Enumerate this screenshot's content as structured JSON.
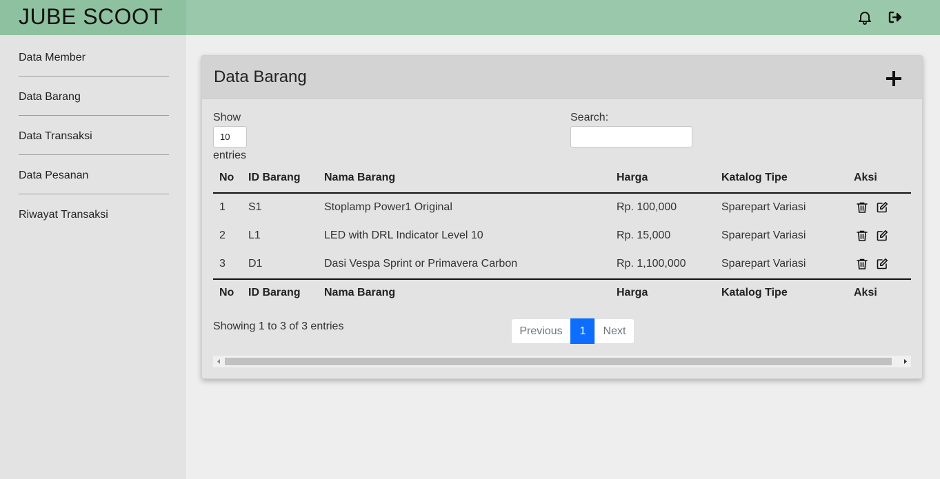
{
  "app": {
    "brand": "JUBE SCOOT"
  },
  "topbar": {
    "icons": [
      "bell-icon",
      "sign-out-icon"
    ]
  },
  "sidebar": {
    "items": [
      {
        "label": "Data Member"
      },
      {
        "label": "Data Barang"
      },
      {
        "label": "Data Transaksi"
      },
      {
        "label": "Data Pesanan"
      },
      {
        "label": "Riwayat Transaksi"
      }
    ]
  },
  "card": {
    "title": "Data Barang",
    "add_icon": "plus-icon"
  },
  "controls": {
    "show_label": "Show",
    "entries_value": "10",
    "entries_label": "entries",
    "search_label": "Search:",
    "search_value": ""
  },
  "table": {
    "columns": [
      "No",
      "ID Barang",
      "Nama Barang",
      "Harga",
      "Katalog Tipe",
      "Aksi"
    ],
    "rows": [
      [
        "1",
        "S1",
        "Stoplamp Power1 Original",
        "Rp. 100,000",
        "Sparepart Variasi"
      ],
      [
        "2",
        "L1",
        "LED with DRL Indicator Level 10",
        "Rp. 15,000",
        "Sparepart Variasi"
      ],
      [
        "3",
        "D1",
        "Dasi Vespa Sprint or Primavera Carbon",
        "Rp. 1,100,000",
        "Sparepart Variasi"
      ]
    ],
    "action_icons": [
      "trash-icon",
      "edit-icon"
    ]
  },
  "footer": {
    "info": "Showing 1 to 3 of 3 entries",
    "previous": "Previous",
    "page": "1",
    "next": "Next"
  },
  "colors": {
    "topbar": "#99c9aa",
    "brand_bg": "#8ec1a0",
    "sidebar": "#e3e3e3",
    "page_bg": "#eeeeee",
    "accent": "#0d6efd"
  }
}
